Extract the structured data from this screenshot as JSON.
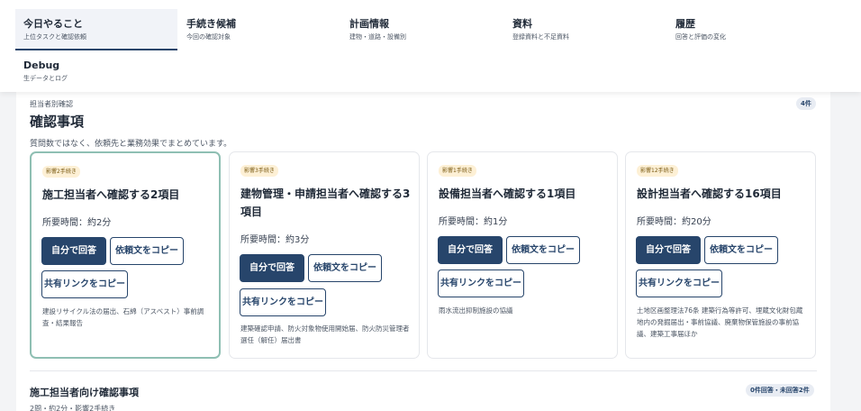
{
  "nav": {
    "tabs": [
      {
        "label": "今日やること",
        "sub": "上位タスクと確認依頼"
      },
      {
        "label": "手続き候補",
        "sub": "今回の確認対象"
      },
      {
        "label": "計画情報",
        "sub": "建物・道路・設備別"
      },
      {
        "label": "資料",
        "sub": "登録資料と不足資料"
      },
      {
        "label": "履歴",
        "sub": "回答と評価の変化"
      },
      {
        "label": "Debug",
        "sub": "生データとログ"
      }
    ]
  },
  "section": {
    "eyebrow": "担当者別確認",
    "title": "確認事項",
    "description": "質問数ではなく、依頼先と業務効果でまとめています。",
    "count": "4件"
  },
  "cards": [
    {
      "badge": "影響2手続き",
      "title": "施工担当者へ確認する2項目",
      "time": "所要時間：約2分",
      "answer_label": "自分で回答",
      "copy_request_label": "依頼文をコピー",
      "share_link_label": "共有リンクをコピー",
      "note": "建設リサイクル法の届出、石綿（アスベスト）事前調査・結果報告"
    },
    {
      "badge": "影響3手続き",
      "title": "建物管理・申請担当者へ確認する3項目",
      "time": "所要時間：約3分",
      "answer_label": "自分で回答",
      "copy_request_label": "依頼文をコピー",
      "share_link_label": "共有リンクをコピー",
      "note": "建築確認申請、防火対象物使用開始届、防火防災管理者選任（解任）届出書"
    },
    {
      "badge": "影響1手続き",
      "title": "設備担当者へ確認する1項目",
      "time": "所要時間：約1分",
      "answer_label": "自分で回答",
      "copy_request_label": "依頼文をコピー",
      "share_link_label": "共有リンクをコピー",
      "note": "雨水流出抑制施設の協議"
    },
    {
      "badge": "影響12手続き",
      "title": "設計担当者へ確認する16項目",
      "time": "所要時間：約20分",
      "answer_label": "自分で回答",
      "copy_request_label": "依頼文をコピー",
      "share_link_label": "共有リンクをコピー",
      "note": "土地区画整理法76条 建築行為等許可、埋蔵文化財包蔵地内の発掘届出・事前協議、廃棄物保管施設の事前協議、建築工事届ほか"
    }
  ],
  "next_section": {
    "title": "施工担当者向け確認事項",
    "meta": "2問・約2分・影響2手続き",
    "status": "0件回答・未回答2件"
  }
}
